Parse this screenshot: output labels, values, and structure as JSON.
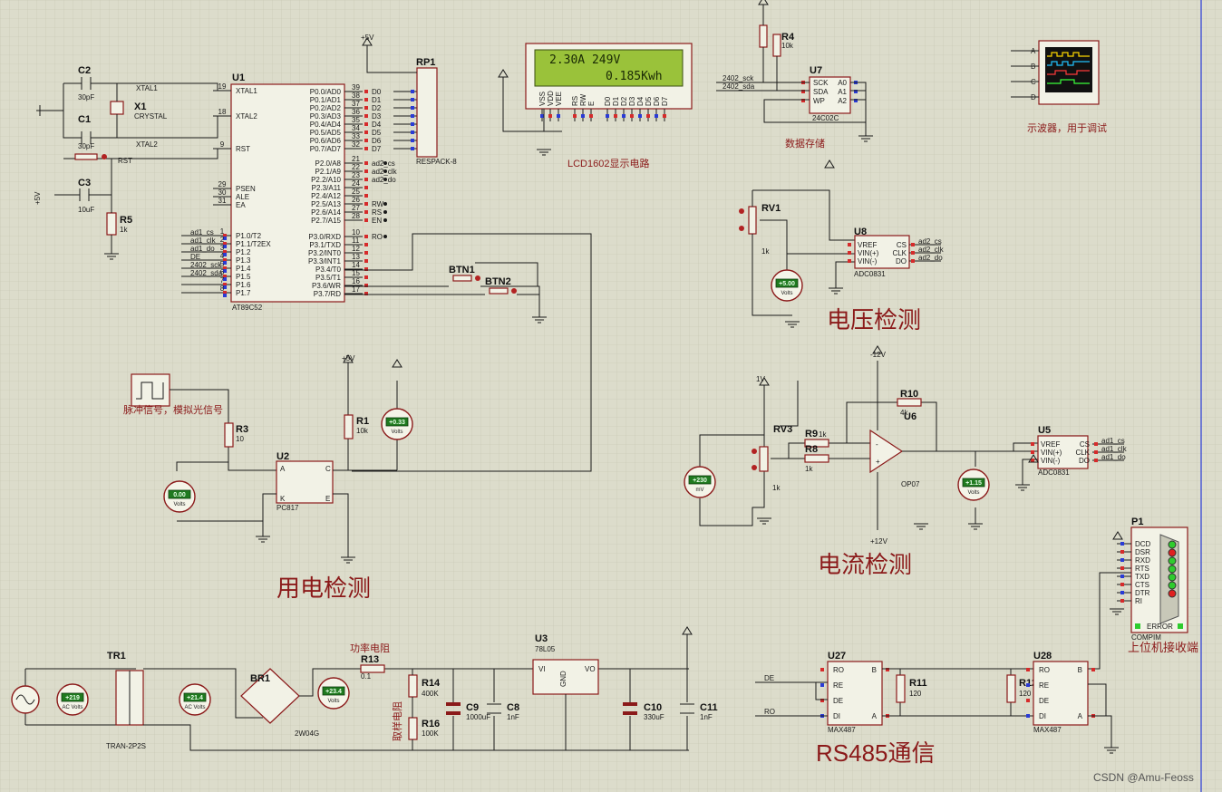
{
  "sections": {
    "voltage_detect": "电压检测",
    "current_detect": "电流检测",
    "power_detect": "用电检测",
    "rs485": "RS485通信",
    "lcd_circuit": "LCD1602显示电路",
    "data_storage": "数据存储",
    "scope_note": "示波器，用于调试",
    "host_receiver": "上位机接收端",
    "pulse_note": "脉冲信号，模拟光信号",
    "power_resistor": "功率电阻",
    "sampling_resistor": "取样电阻"
  },
  "lcd": {
    "line1": "2.30A  249V",
    "line2": "0.185Kwh",
    "pins": [
      "VSS",
      "VDD",
      "VEE",
      "RS",
      "RW",
      "E",
      "D0",
      "D1",
      "D2",
      "D3",
      "D4",
      "D5",
      "D6",
      "D7"
    ]
  },
  "mcu": {
    "ref": "U1",
    "part": "AT89C52",
    "left_pins": [
      {
        "n": "19",
        "name": "XTAL1"
      },
      {
        "n": "18",
        "name": "XTAL2"
      },
      {
        "n": "9",
        "name": "RST"
      },
      {
        "n": "29",
        "name": "PSEN"
      },
      {
        "n": "30",
        "name": "ALE"
      },
      {
        "n": "31",
        "name": "EA"
      },
      {
        "n": "1",
        "name": "P1.0/T2"
      },
      {
        "n": "2",
        "name": "P1.1/T2EX"
      },
      {
        "n": "3",
        "name": "P1.2"
      },
      {
        "n": "4",
        "name": "P1.3"
      },
      {
        "n": "5",
        "name": "P1.4"
      },
      {
        "n": "6",
        "name": "P1.5"
      },
      {
        "n": "7",
        "name": "P1.6"
      },
      {
        "n": "8",
        "name": "P1.7"
      }
    ],
    "left_nets": [
      "ad1_cs",
      "ad1_clk",
      "ad1_do",
      "DE",
      "2402_sck",
      "2402_sda",
      "",
      ""
    ],
    "right_pins": [
      {
        "n": "39",
        "name": "P0.0/AD0",
        "net": "D0"
      },
      {
        "n": "38",
        "name": "P0.1/AD1",
        "net": "D1"
      },
      {
        "n": "37",
        "name": "P0.2/AD2",
        "net": "D2"
      },
      {
        "n": "36",
        "name": "P0.3/AD3",
        "net": "D3"
      },
      {
        "n": "35",
        "name": "P0.4/AD4",
        "net": "D4"
      },
      {
        "n": "34",
        "name": "P0.5/AD5",
        "net": "D5"
      },
      {
        "n": "33",
        "name": "P0.6/AD6",
        "net": "D6"
      },
      {
        "n": "32",
        "name": "P0.7/AD7",
        "net": "D7"
      },
      {
        "n": "21",
        "name": "P2.0/A8",
        "net": "ad2_cs"
      },
      {
        "n": "22",
        "name": "P2.1/A9",
        "net": "ad2_clk"
      },
      {
        "n": "23",
        "name": "P2.2/A10",
        "net": "ad2_do"
      },
      {
        "n": "24",
        "name": "P2.3/A11",
        "net": ""
      },
      {
        "n": "25",
        "name": "P2.4/A12",
        "net": ""
      },
      {
        "n": "26",
        "name": "P2.5/A13",
        "net": "RW"
      },
      {
        "n": "27",
        "name": "P2.6/A14",
        "net": "RS"
      },
      {
        "n": "28",
        "name": "P2.7/A15",
        "net": "EN"
      },
      {
        "n": "10",
        "name": "P3.0/RXD",
        "net": "RO"
      },
      {
        "n": "11",
        "name": "P3.1/TXD",
        "net": ""
      },
      {
        "n": "12",
        "name": "P3.2/INT0",
        "net": ""
      },
      {
        "n": "13",
        "name": "P3.3/INT1",
        "net": ""
      },
      {
        "n": "14",
        "name": "P3.4/T0",
        "net": ""
      },
      {
        "n": "15",
        "name": "P3.5/T1",
        "net": ""
      },
      {
        "n": "16",
        "name": "P3.6/WR",
        "net": ""
      },
      {
        "n": "17",
        "name": "P3.7/RD",
        "net": ""
      }
    ]
  },
  "components": {
    "c2": {
      "ref": "C2",
      "val": "30pF"
    },
    "c1": {
      "ref": "C1",
      "val": "30pF"
    },
    "x1": {
      "ref": "X1",
      "val": "CRYSTAL"
    },
    "c3": {
      "ref": "C3",
      "val": "10uF"
    },
    "r5": {
      "ref": "R5",
      "val": "1k"
    },
    "rp1": {
      "ref": "RP1",
      "val": "RESPACK-8"
    },
    "r4": {
      "ref": "R4",
      "val": "10k"
    },
    "u7": {
      "ref": "U7",
      "val": "24C02C"
    },
    "rv1": {
      "ref": "RV1",
      "val": "1k"
    },
    "u8": {
      "ref": "U8",
      "val": "ADC0831"
    },
    "btn1": {
      "ref": "BTN1"
    },
    "btn2": {
      "ref": "BTN2"
    },
    "r3": {
      "ref": "R3",
      "val": "10"
    },
    "r1": {
      "ref": "R1",
      "val": "10k"
    },
    "u2": {
      "ref": "U2",
      "val": "PC817"
    },
    "rv3": {
      "ref": "RV3",
      "val": "1k"
    },
    "r9": {
      "ref": "R9",
      "val": "1k"
    },
    "r8": {
      "ref": "R8",
      "val": "1k"
    },
    "r10": {
      "ref": "R10",
      "val": "4k"
    },
    "u6": {
      "ref": "U6",
      "val": "OP07"
    },
    "u5": {
      "ref": "U5",
      "val": "ADC0831"
    },
    "p1": {
      "ref": "P1",
      "val": "COMPIM"
    },
    "tr1": {
      "ref": "TR1",
      "val": "TRAN-2P2S"
    },
    "br1": {
      "ref": "BR1",
      "val": "2W04G"
    },
    "r13": {
      "ref": "R13",
      "val": "0.1"
    },
    "r14": {
      "ref": "R14",
      "val": "400K"
    },
    "r16": {
      "ref": "R16",
      "val": "100K"
    },
    "u3": {
      "ref": "U3",
      "val": "78L05"
    },
    "c9": {
      "ref": "C9",
      "val": "1000uF"
    },
    "c8": {
      "ref": "C8",
      "val": "1nF"
    },
    "c10": {
      "ref": "C10",
      "val": "330uF"
    },
    "c11": {
      "ref": "C11",
      "val": "1nF"
    },
    "u27": {
      "ref": "U27",
      "val": "MAX487"
    },
    "r11": {
      "ref": "R11",
      "val": "120"
    },
    "r12": {
      "ref": "R12",
      "val": "120"
    },
    "u28": {
      "ref": "U28",
      "val": "MAX487"
    }
  },
  "adc_pins": {
    "left": [
      "VREF",
      "VIN(+)",
      "VIN(-)"
    ],
    "right": [
      "CS",
      "CLK",
      "DO"
    ]
  },
  "adc1_nets": [
    "ad1_cs",
    "ad1_clk",
    "ad1_do"
  ],
  "adc2_nets": [
    "ad2_cs",
    "ad2_clk",
    "ad2_do"
  ],
  "eeprom_pins": {
    "left": [
      "SCK",
      "SDA",
      "WP"
    ],
    "right": [
      "A0",
      "A1",
      "A2"
    ],
    "nets": [
      "2402_sck",
      "2402_sda"
    ]
  },
  "max487_pins": {
    "left": [
      "RO",
      "RE",
      "DE",
      "DI"
    ],
    "right": [
      "B",
      "A"
    ]
  },
  "max487_nets": {
    "u27_de": "DE",
    "u27_ro": "RO"
  },
  "compim_pins": [
    "DCD",
    "DSR",
    "RXD",
    "RTS",
    "TXD",
    "CTS",
    "DTR",
    "RI"
  ],
  "compim_error": "ERROR",
  "scope_channels": [
    "A",
    "B",
    "C",
    "D"
  ],
  "meters": {
    "v_u8": {
      "value": "+5.00",
      "unit": "Volts"
    },
    "v_r1": {
      "value": "+0.33",
      "unit": "Volts"
    },
    "v_u2": {
      "value": "0.00",
      "unit": "Volts"
    },
    "mv_rv3": {
      "value": "+230",
      "unit": "mV"
    },
    "v_u6": {
      "value": "+1.15",
      "unit": "Volts"
    },
    "ac1": {
      "value": "+219",
      "unit": "AC Volts"
    },
    "ac2": {
      "value": "+21.4",
      "unit": "AC Volts"
    },
    "v_br": {
      "value": "+23.4",
      "unit": "Volts"
    }
  },
  "rails": {
    "p5v": "+5V",
    "n12": "-12V",
    "p12": "+12V",
    "v1": "1V"
  },
  "xtal_nets": [
    "XTAL1",
    "XTAL2",
    "RST"
  ],
  "watermark": "CSDN @Amu-Feoss"
}
